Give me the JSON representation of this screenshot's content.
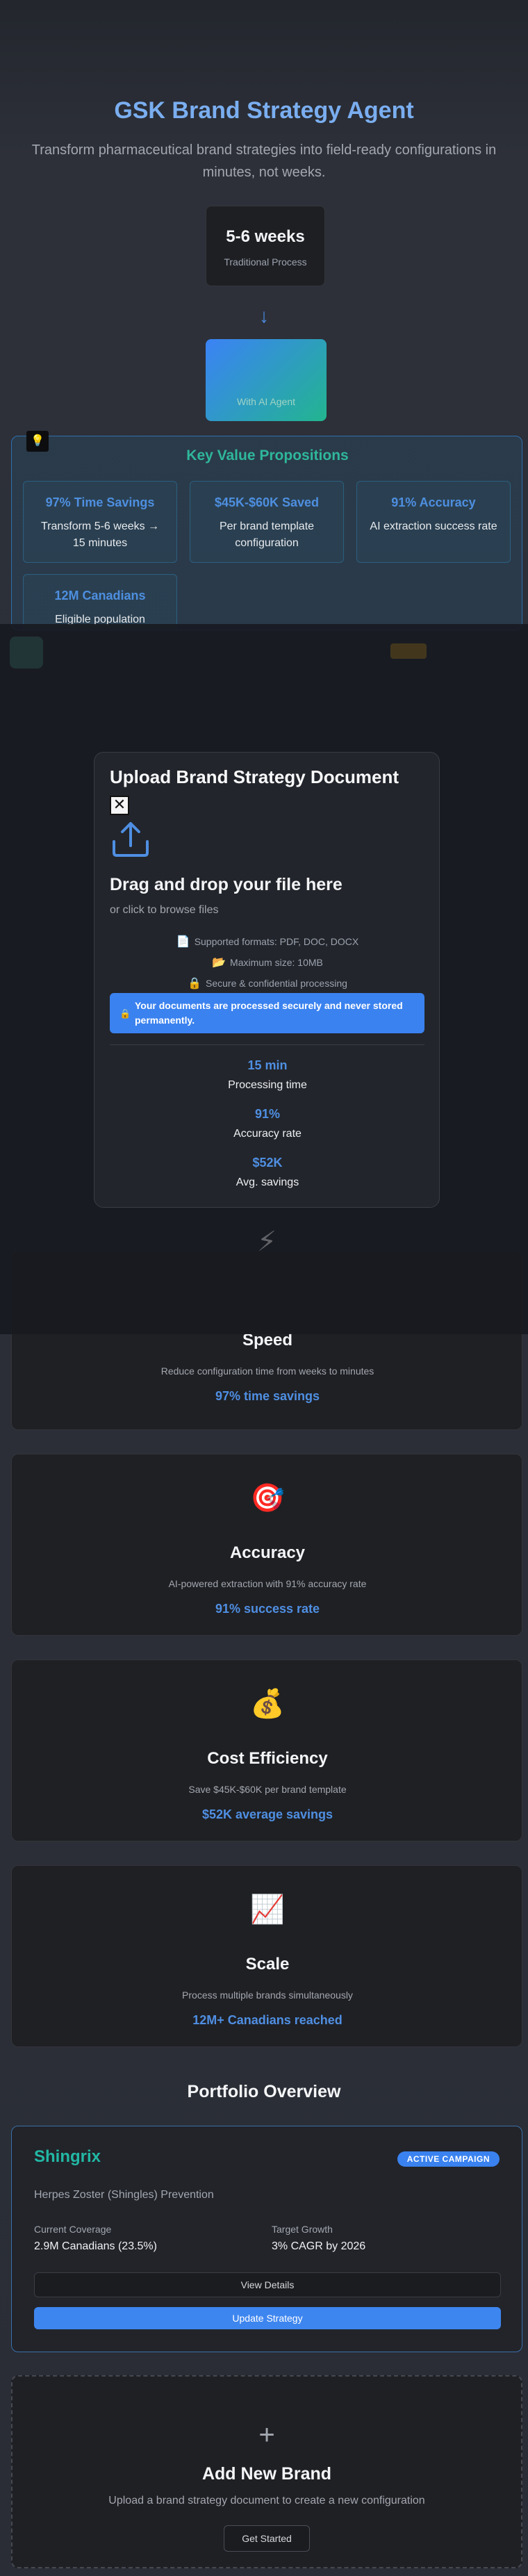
{
  "hero": {
    "title": "GSK Brand Strategy Agent",
    "subtitle": "Transform pharmaceutical brand strategies into field-ready configurations in minutes, not weeks."
  },
  "comparison": {
    "traditional_value": "5-6 weeks",
    "traditional_label": "Traditional Process",
    "arrow": "↓",
    "ai_label": "With AI Agent"
  },
  "value_props": {
    "title": "Key Value Propositions",
    "items": [
      {
        "title": "97% Time Savings",
        "desc": "Transform 5-6 weeks → 15 minutes"
      },
      {
        "title": "$45K-$60K Saved",
        "desc": "Per brand template configuration"
      },
      {
        "title": "91% Accuracy",
        "desc": "AI extraction success rate"
      },
      {
        "title": "12M Canadians",
        "desc": "Eligible population"
      }
    ]
  },
  "modal": {
    "title": "Upload Brand Strategy Document",
    "close": "✕",
    "drop_title": "Drag and drop your file here",
    "drop_sub": "or click to browse files",
    "formats": "Supported formats: PDF, DOC, DOCX",
    "max_size": "Maximum size: 10MB",
    "secure": "Secure & confidential processing",
    "banner": "Your documents are processed securely and never stored permanently.",
    "stats": [
      {
        "value": "15 min",
        "label": "Processing time"
      },
      {
        "value": "91%",
        "label": "Accuracy rate"
      },
      {
        "value": "$52K",
        "label": "Avg. savings"
      }
    ]
  },
  "features": [
    {
      "icon": "lightning-icon",
      "emoji": "⚡",
      "title": "Speed",
      "desc": "Reduce configuration time from weeks to minutes",
      "highlight": "97% time savings"
    },
    {
      "icon": "target-icon",
      "emoji": "🎯",
      "title": "Accuracy",
      "desc": "AI-powered extraction with 91% accuracy rate",
      "highlight": "91% success rate"
    },
    {
      "icon": "money-bag-icon",
      "emoji": "💰",
      "title": "Cost Efficiency",
      "desc": "Save $45K-$60K per brand template",
      "highlight": "$52K average savings"
    },
    {
      "icon": "chart-icon",
      "emoji": "📈",
      "title": "Scale",
      "desc": "Process multiple brands simultaneously",
      "highlight": "12M+ Canadians reached"
    }
  ],
  "portfolio": {
    "title": "Portfolio Overview",
    "brand": {
      "name": "Shingrix",
      "badge": "ACTIVE CAMPAIGN",
      "desc": "Herpes Zoster (Shingles) Prevention",
      "coverage_label": "Current Coverage",
      "coverage_value": "2.9M Canadians (23.5%)",
      "growth_label": "Target Growth",
      "growth_value": "3% CAGR by 2026",
      "view_btn": "View Details",
      "update_btn": "Update Strategy"
    },
    "add": {
      "plus": "+",
      "title": "Add New Brand",
      "desc": "Upload a brand strategy document to create a new configuration",
      "btn": "Get Started"
    }
  },
  "colors": {
    "accent_blue": "#3a82ef",
    "title_blue": "#7aaef0",
    "teal": "#22b8a4",
    "background": "#2a2d35"
  }
}
